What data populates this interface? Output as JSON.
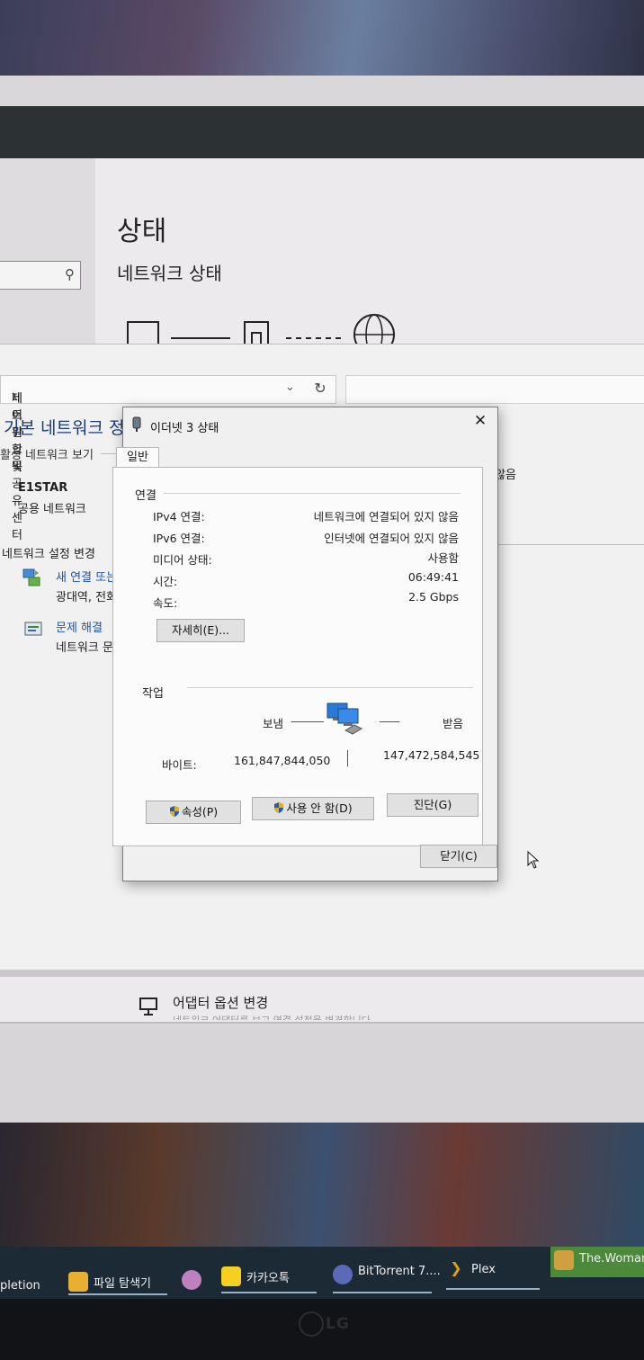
{
  "settings": {
    "title": "상태",
    "subtitle": "네트워크 상태",
    "adapter_option": "어댑터 옵션 변경",
    "adapter_option_desc": "네트워크 어댑터를 보고 연결 설정을 변경합니다."
  },
  "control_panel": {
    "breadcrumb": [
      "제어판 항목",
      "네트워크 및 공유 센터"
    ],
    "heading": "기본 네트워크 정",
    "active_networks": "활성 네트워크 보기",
    "network_name": "E1STAR",
    "network_type": "공용 네트워크",
    "change_settings": "네트워크 설정 변경",
    "new_connection_link": "새 연결 또는",
    "new_connection_desc": "광대역, 전화",
    "troubleshoot_link": "문제 해결",
    "troubleshoot_desc": "네트워크 문",
    "right_snippet": "않음"
  },
  "dialog": {
    "title": "이더넷 3 상태",
    "close_icon": "close-icon",
    "tab_general": "일반",
    "connection": {
      "group_label": "연결",
      "rows": [
        {
          "label": "IPv4 연결:",
          "value": "네트워크에 연결되어 있지 않음"
        },
        {
          "label": "IPv6 연결:",
          "value": "인터넷에 연결되어 있지 않음"
        },
        {
          "label": "미디어 상태:",
          "value": "사용함"
        },
        {
          "label": "시간:",
          "value": "06:49:41"
        },
        {
          "label": "속도:",
          "value": "2.5 Gbps"
        }
      ],
      "details_button": "자세히(E)..."
    },
    "activity": {
      "group_label": "작업",
      "sent_label": "보냄",
      "received_label": "받음",
      "bytes_label": "바이트:",
      "bytes_sent": "161,847,844,050",
      "bytes_received": "147,472,584,545"
    },
    "buttons": {
      "properties": "속성(P)",
      "disable": "사용 안 함(D)",
      "diagnose": "진단(G)",
      "close": "닫기(C)"
    }
  },
  "taskbar": {
    "items": [
      {
        "label": "pletion",
        "icon": "app-icon"
      },
      {
        "label": "파일 탐색기",
        "icon": "folder-icon"
      },
      {
        "label": "",
        "icon": "app-circle-icon"
      },
      {
        "label": "카카오톡",
        "icon": "kakaotalk-icon"
      },
      {
        "label": "BitTorrent 7....",
        "icon": "bittorrent-icon"
      },
      {
        "label": "Plex",
        "icon": "plex-icon"
      },
      {
        "label": "The.Woman...",
        "icon": "media-player-icon"
      }
    ]
  },
  "monitor_brand": "LG",
  "colors": {
    "link_blue": "#1a54b4",
    "heading_blue": "#1e3c78",
    "taskbar": "#1c2a36"
  }
}
